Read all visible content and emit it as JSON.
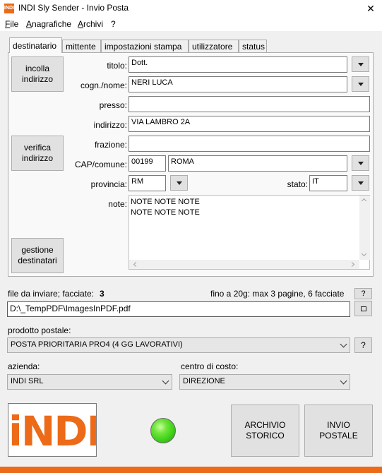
{
  "window": {
    "icon_text": "INDI",
    "title": "INDI Sly Sender - Invio Posta",
    "close": "✕"
  },
  "menu": [
    "File",
    "Anagrafiche",
    "Archivi",
    "?"
  ],
  "tabs": [
    "destinatario",
    "mittente",
    "impostazioni stampa",
    "utilizzatore",
    "status"
  ],
  "buttons": {
    "incolla": "incolla\nindirizzo",
    "verifica": "verifica\nindirizzo",
    "gestione": "gestione\ndestinatari",
    "archivio": "ARCHIVIO\nSTORICO",
    "invio": "INVIO\nPOSTALE",
    "help": "?"
  },
  "form": {
    "titolo_label": "titolo:",
    "titolo": "Dott.",
    "cognome_label": "cogn./nome:",
    "cognome": "NERI LUCA",
    "presso_label": "presso:",
    "presso": "",
    "indirizzo_label": "indirizzo:",
    "indirizzo": "VIA LAMBRO 2A",
    "frazione_label": "frazione:",
    "frazione": "",
    "cap_label": "CAP/comune:",
    "cap": "00199",
    "comune": "ROMA",
    "provincia_label": "provincia:",
    "provincia": "RM",
    "stato_label": "stato:",
    "stato": "IT",
    "note_label": "note:",
    "note": "NOTE NOTE NOTE\nNOTE NOTE NOTE"
  },
  "file": {
    "label": "file da inviare; facciate:",
    "facciate": "3",
    "limit": "fino a 20g: max 3 pagine, 6 facciate",
    "path": "D:\\_TempPDF\\ImagesInPDF.pdf"
  },
  "product": {
    "label": "prodotto postale:",
    "value": "POSTA PRIORITARIA PRO4 (4 GG LAVORATIVI)"
  },
  "azienda": {
    "label": "azienda:",
    "value": "INDI SRL"
  },
  "centro": {
    "label": "centro di costo:",
    "value": "DIREZIONE"
  },
  "logo_text": "iNDI",
  "colors": {
    "brand_orange": "#ec6a18",
    "status_light": "#3fd21a"
  }
}
